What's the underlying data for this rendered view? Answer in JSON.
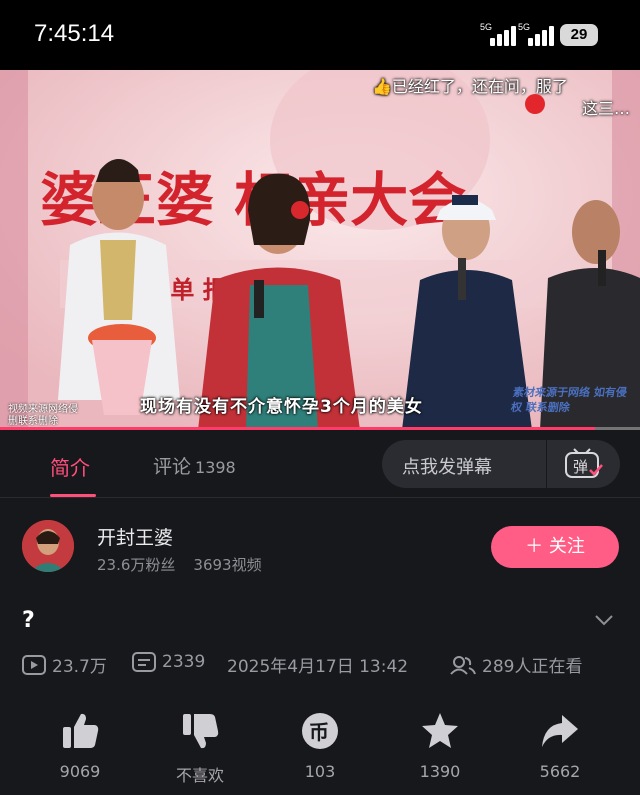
{
  "status_bar": {
    "time": "7:45:14",
    "signal_1_label": "5G",
    "signal_2_label": "5G",
    "battery": "29"
  },
  "video": {
    "banner_text": "婆王婆 相亲大会",
    "sub_banner_text": "走进 速脱单 报名 免费",
    "danmaku_text_line1": "已经红了，还在问，服了",
    "danmaku_text_line2": "这三…",
    "rec_label": "REC",
    "caption": "现场有没有不介意怀孕3个月的美女",
    "watermark_left": "视频来源网络侵删联系删除",
    "watermark_right": "素材来源于网络 如有侵权 联系删除",
    "progress": 0.93,
    "accent": "#ff3b6a"
  },
  "tabs": {
    "intro": "简介",
    "comments": "评论",
    "comments_count": "1398",
    "danmaku_placeholder": "点我发弹幕",
    "danmaku_button": "弹"
  },
  "uploader": {
    "name": "开封王婆",
    "fans": "23.6万粉丝",
    "videos": "3693视频",
    "follow_label": "＋ 关注",
    "follow_color": "#ff5c86"
  },
  "video_info": {
    "title": "?",
    "views": "23.7万",
    "danmaku_count": "2339",
    "datetime": "2025年4月17日 13:42",
    "watching": "289人正在看"
  },
  "actions": [
    {
      "icon": "thumbs-up-icon",
      "label": "9069"
    },
    {
      "icon": "thumbs-down-icon",
      "label": "不喜欢"
    },
    {
      "icon": "coin-icon",
      "label": "103"
    },
    {
      "icon": "star-icon",
      "label": "1390"
    },
    {
      "icon": "share-icon",
      "label": "5662"
    }
  ]
}
